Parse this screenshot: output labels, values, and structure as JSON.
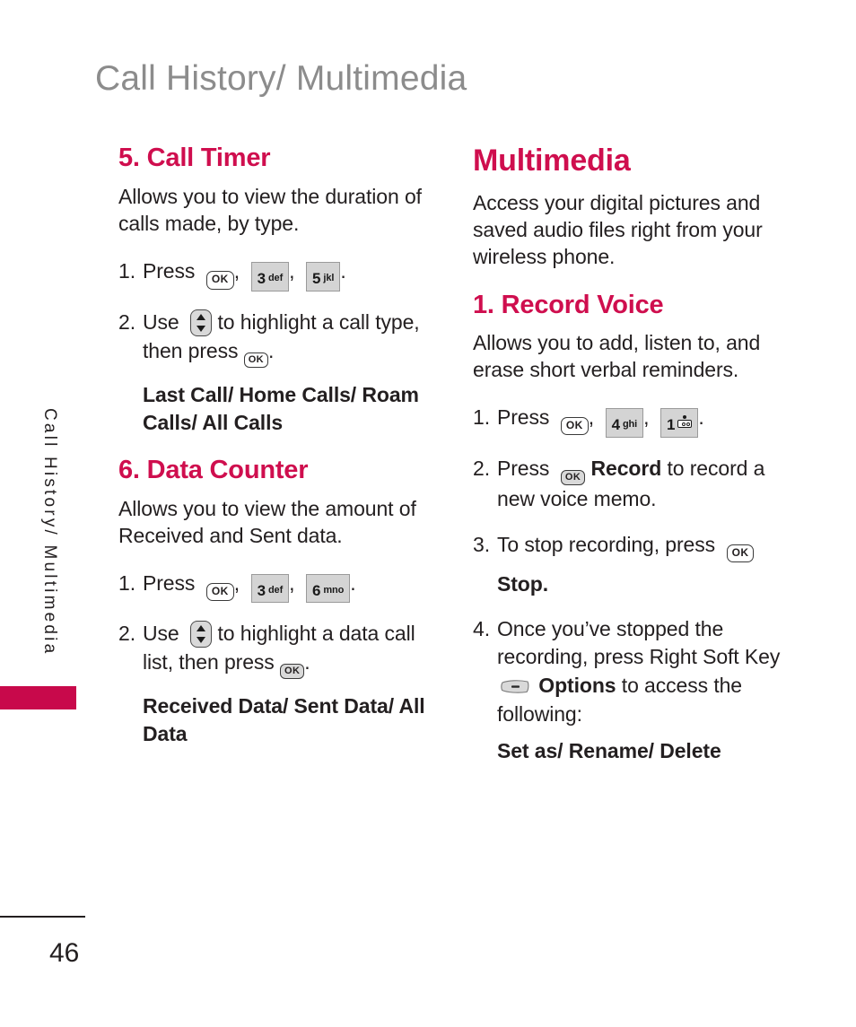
{
  "header": {
    "title": "Call History/ Multimedia"
  },
  "sidebar": {
    "label": "Call History/ Multimedia"
  },
  "footer": {
    "page_number": "46"
  },
  "colors": {
    "accent_magenta": "#CF0E4E",
    "tab_magenta": "#C8094B",
    "header_gray": "#8C8C8C",
    "body_black": "#231F20",
    "key_gray": "#D4D4D4"
  },
  "left_column": {
    "sections": [
      {
        "heading": "5. Call Timer",
        "intro": "Allows you to view the duration of calls made, by type.",
        "steps": [
          {
            "number": "1.",
            "text_before": "Press",
            "keys": [
              "ok",
              "3-def",
              "5-jkl"
            ],
            "text_after": "."
          },
          {
            "number": "2.",
            "text_before": "Use",
            "text_mid": "to highlight a call type, then press",
            "text_after": ".",
            "sub_bold": "Last Call/ Home Calls/ Roam Calls/ All Calls"
          }
        ]
      },
      {
        "heading": "6. Data Counter",
        "intro": "Allows you to view the amount of Received and Sent data.",
        "steps": [
          {
            "number": "1.",
            "text_before": "Press",
            "keys": [
              "ok",
              "3-def",
              "6-mno"
            ],
            "text_after": "."
          },
          {
            "number": "2.",
            "text_before": "Use",
            "text_mid": "to highlight a data call list, then press",
            "text_after": ".",
            "sub_bold": "Received Data/ Sent Data/ All Data"
          }
        ]
      }
    ]
  },
  "right_column": {
    "title": "Multimedia",
    "intro": "Access your digital pictures and saved audio files right from your wireless phone.",
    "sections": [
      {
        "heading": "1. Record Voice",
        "intro": "Allows you to add, listen to, and erase short verbal reminders.",
        "steps": [
          {
            "number": "1.",
            "text_before": "Press",
            "keys": [
              "ok",
              "4-ghi",
              "1-voicemail"
            ],
            "text_after": "."
          },
          {
            "number": "2.",
            "text_before": "Press",
            "bold_word": "Record",
            "text_after": "to record a new voice memo."
          },
          {
            "number": "3.",
            "text_before": "To stop recording, press",
            "bold_word": "Stop.",
            "text_after": ""
          },
          {
            "number": "4.",
            "text_before": "Once you’ve stopped the recording, press Right Soft Key",
            "bold_word": "Options",
            "text_after": "to access the following:",
            "sub_bold": "Set as/ Rename/ Delete"
          }
        ]
      }
    ]
  },
  "keys": {
    "ok": {
      "label": "OK",
      "name": "ok-key"
    },
    "three": {
      "digit": "3",
      "letters": "def"
    },
    "four": {
      "digit": "4",
      "letters": "ghi"
    },
    "five": {
      "digit": "5",
      "letters": "jkl"
    },
    "six": {
      "digit": "6",
      "letters": "mno"
    },
    "one": {
      "digit": "1",
      "letters": ""
    },
    "nav": {
      "name": "up-down-navigation-key"
    },
    "soft": {
      "name": "right-soft-key"
    }
  }
}
